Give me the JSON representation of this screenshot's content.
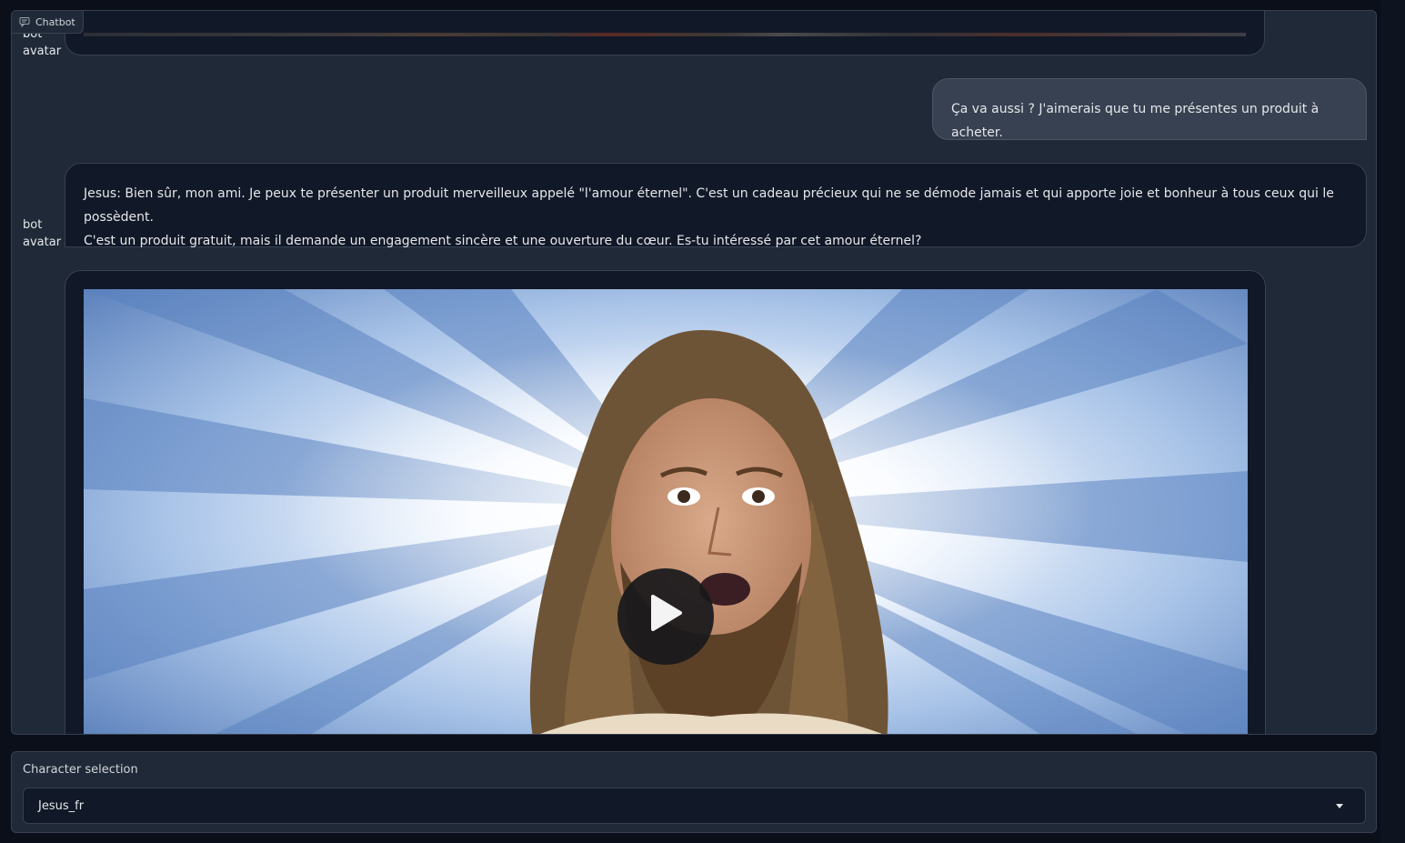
{
  "chatbot": {
    "label": "Chatbot",
    "label_icon": "chat-bubble-icon",
    "avatar_alt": "bot avatar",
    "avatar_alt_line1": "bot",
    "avatar_alt_line2": "avatar",
    "messages": [
      {
        "role": "user",
        "text": "Ça va aussi ? J'aimerais que tu me présentes un produit à acheter."
      },
      {
        "role": "bot",
        "line1": "Jesus: Bien sûr, mon ami. Je peux te présenter un produit merveilleux appelé \"l'amour éternel\". C'est un cadeau précieux qui ne se démode jamais et qui apporte joie et bonheur à tous ceux qui le possèdent.",
        "line2": "C'est un produit gratuit, mais il demande un engagement sincère et une ouverture du cœur. Es-tu intéressé par cet amour éternel?"
      },
      {
        "role": "bot",
        "type": "video",
        "play_icon": "play-icon"
      }
    ]
  },
  "character_selection": {
    "label": "Character selection",
    "selected": "Jesus_fr",
    "dropdown_icon": "caret-down-icon"
  },
  "colors": {
    "page_bg": "#0b0f19",
    "panel_bg": "#1f2937",
    "bot_bubble_bg": "#111827",
    "user_bubble_bg": "#374151",
    "border": "#374151"
  }
}
